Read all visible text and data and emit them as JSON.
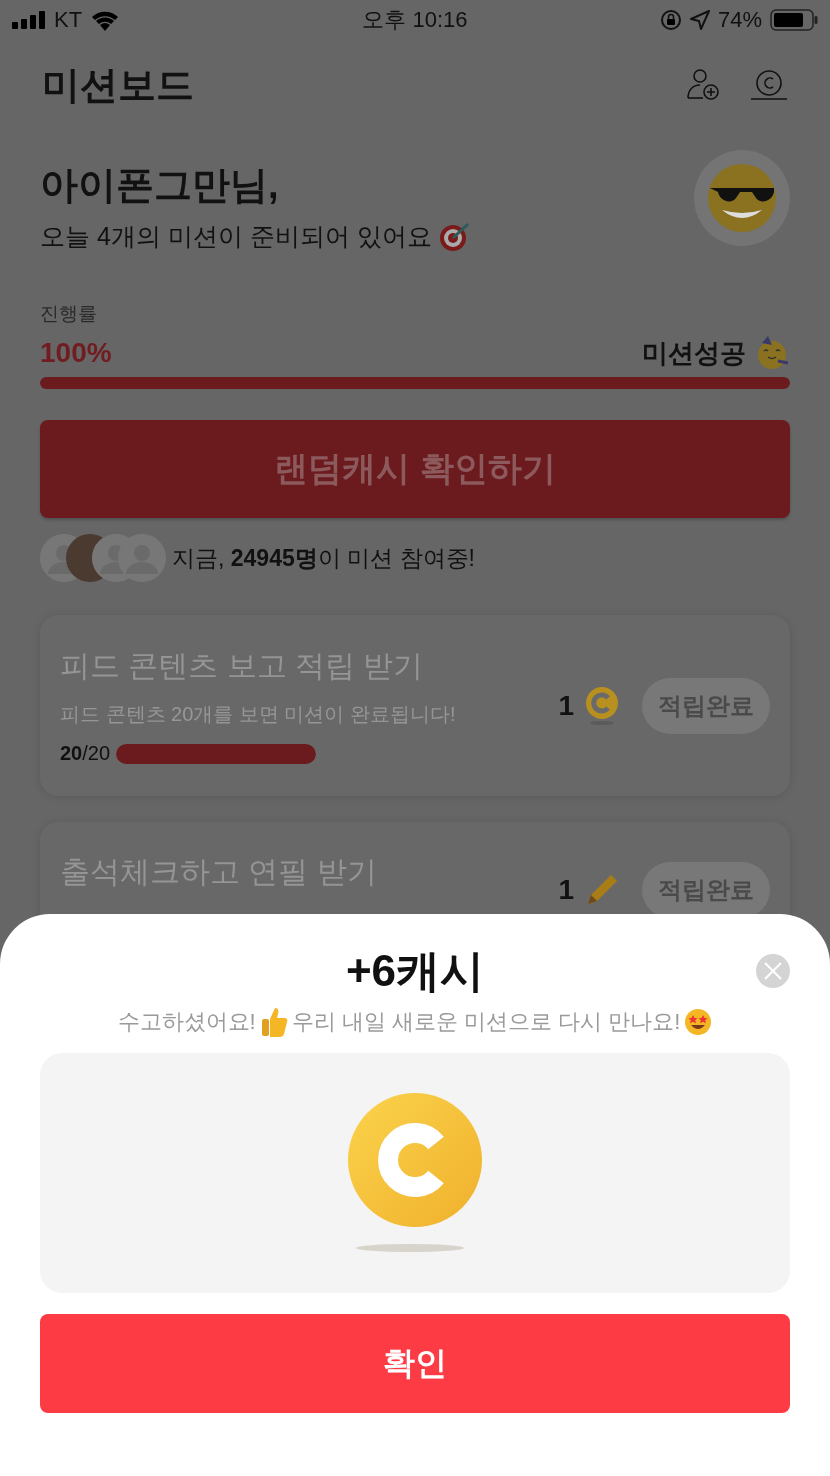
{
  "status_bar": {
    "carrier": "KT",
    "time": "오후 10:16",
    "battery": "74%"
  },
  "header": {
    "title": "미션보드"
  },
  "greeting": {
    "name": "아이폰그만님,",
    "message": "오늘 4개의 미션이 준비되어 있어요"
  },
  "progress": {
    "label": "진행률",
    "value": "100%",
    "status": "미션성공",
    "level": 1
  },
  "random_cash_button": "랜덤캐시 확인하기",
  "participants": {
    "text": "지금, **24945명**이 미션 참여중!"
  },
  "missions": [
    {
      "kind": "coin",
      "title": "피드 콘텐츠 보고 적립 받기",
      "description": "피드 콘텐츠 20개를 보면 미션이 완료됩니다!",
      "count": "**20**/20",
      "level": 1,
      "reward": "1",
      "button": "적립완료"
    },
    {
      "kind": "pencil",
      "title": "출석체크하고 연필 받기",
      "reward": "1",
      "button": "적립완료"
    }
  ],
  "modal": {
    "title": "+6캐시",
    "message_parts": [
      "수고하셨어요!",
      "우리 내일 새로운 미션으로 다시 만나요!"
    ],
    "confirm_button": "확인"
  }
}
